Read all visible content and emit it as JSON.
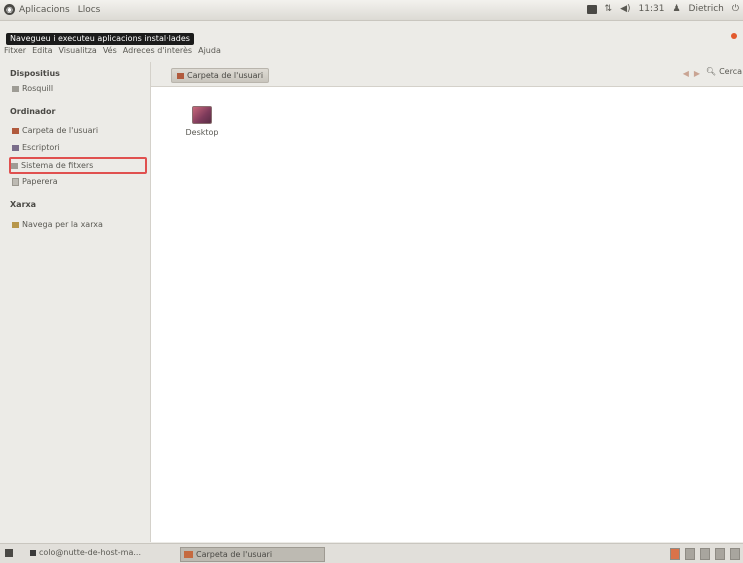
{
  "topbar": {
    "applications": "Aplicacions",
    "places": "Llocs",
    "clock": "11:31",
    "user": "Dietrich"
  },
  "tooltip": "Navegueu i executeu aplicacions instal·lades",
  "menubar": [
    "Fitxer",
    "Edita",
    "Visualitza",
    "Vés",
    "Adreces d'interès",
    "Ajuda"
  ],
  "sidebar": {
    "devices_heading": "Dispositius",
    "devices": [
      {
        "label": "Rosquill",
        "icon": "drive-icon"
      }
    ],
    "computer_heading": "Ordinador",
    "computer": [
      {
        "label": "Carpeta de l'usuari",
        "icon": "home-icon"
      },
      {
        "label": "Escriptori",
        "icon": "desktop-icon"
      },
      {
        "label": "Sistema de fitxers",
        "icon": "drive-icon"
      },
      {
        "label": "Paperera",
        "icon": "trash-icon"
      }
    ],
    "network_heading": "Xarxa",
    "network": [
      {
        "label": "Navega per la xarxa",
        "icon": "network-icon"
      }
    ]
  },
  "content": {
    "breadcrumb": "Carpeta de l'usuari",
    "search_label": "Cerca",
    "items": [
      {
        "label": "Desktop",
        "icon": "folder-icon"
      }
    ]
  },
  "taskbar": {
    "task1": "colo@nutte-de-host-ma...",
    "task2": "Carpeta de l'usuari"
  },
  "colors": {
    "selection_outline": "#e0504f",
    "accent": "#e2592d"
  }
}
